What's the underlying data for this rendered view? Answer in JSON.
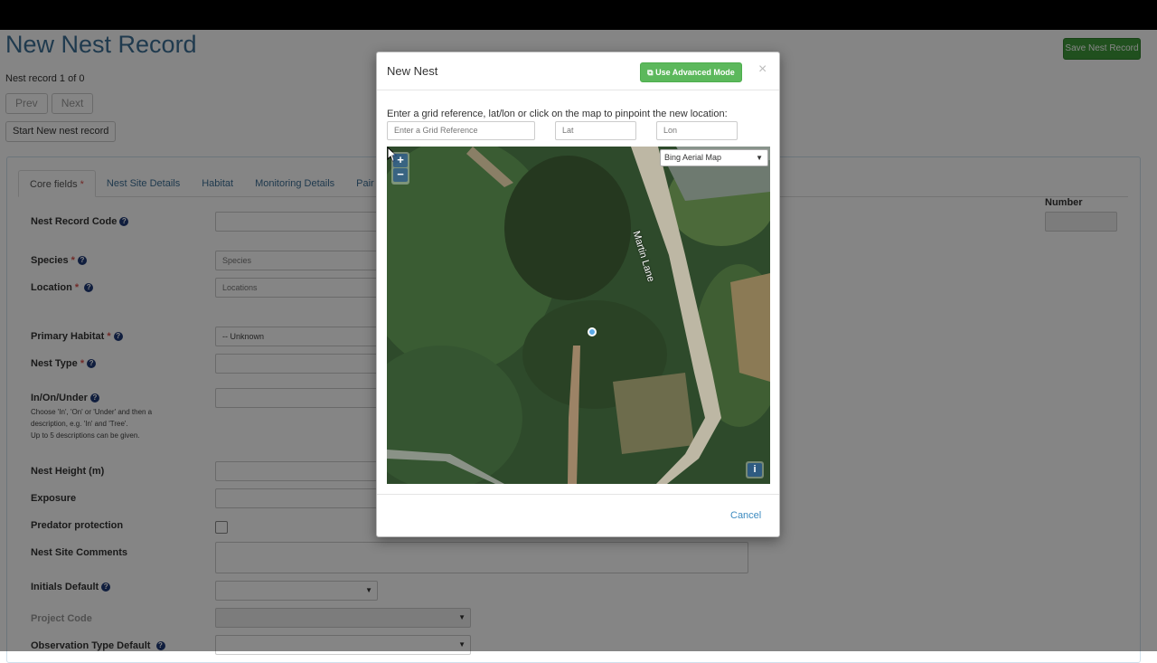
{
  "page": {
    "title": "New Nest Record",
    "save_button": "Save Nest Record",
    "record_count": "Nest record 1 of 0",
    "prev_button": "Prev",
    "next_button": "Next",
    "start_new_button": "Start New nest record",
    "tabs": [
      "Core fields",
      "Nest Site Details",
      "Habitat",
      "Monitoring Details",
      "Pair D"
    ],
    "required_marker": "*",
    "help_glyph": "?",
    "fields": {
      "nest_record_code": "Nest Record Code",
      "species": "Species",
      "species_placeholder": "Species",
      "location": "Location",
      "location_placeholder": "Locations",
      "primary_habitat": "Primary Habitat",
      "primary_habitat_value": "-- Unknown",
      "nest_type": "Nest Type",
      "in_on_under": "In/On/Under",
      "in_on_under_hint_1": "Choose 'In', 'On' or 'Under' and then a",
      "in_on_under_hint_2": "description, e.g. 'In' and 'Tree'.",
      "in_on_under_hint_3": "Up to 5 descriptions can be given.",
      "nest_height": "Nest Height (m)",
      "exposure": "Exposure",
      "predator_protection": "Predator protection",
      "nest_site_comments": "Nest Site Comments",
      "initials_default": "Initials Default",
      "project_code": "Project Code",
      "observation_type_default": "Observation Type Default",
      "number": "Number"
    }
  },
  "modal": {
    "title": "New Nest",
    "advanced_button": "Use Advanced Mode",
    "close_glyph": "×",
    "instruction": "Enter a grid reference, lat/lon or click on the map to pinpoint the new location:",
    "grid_ref_placeholder": "Enter a Grid Reference",
    "lat_placeholder": "Lat",
    "lon_placeholder": "Lon",
    "map": {
      "layer_selected": "Bing Aerial Map",
      "road_label": "Martin Lane",
      "zoom_in": "+",
      "zoom_out": "−",
      "info": "i"
    },
    "cancel": "Cancel"
  },
  "colors": {
    "title_blue": "#3d6f96",
    "save_green": "#3f9a3a",
    "advanced_green": "#5cb85c",
    "link_blue": "#3d8bc0",
    "required_red": "#d9534f"
  }
}
